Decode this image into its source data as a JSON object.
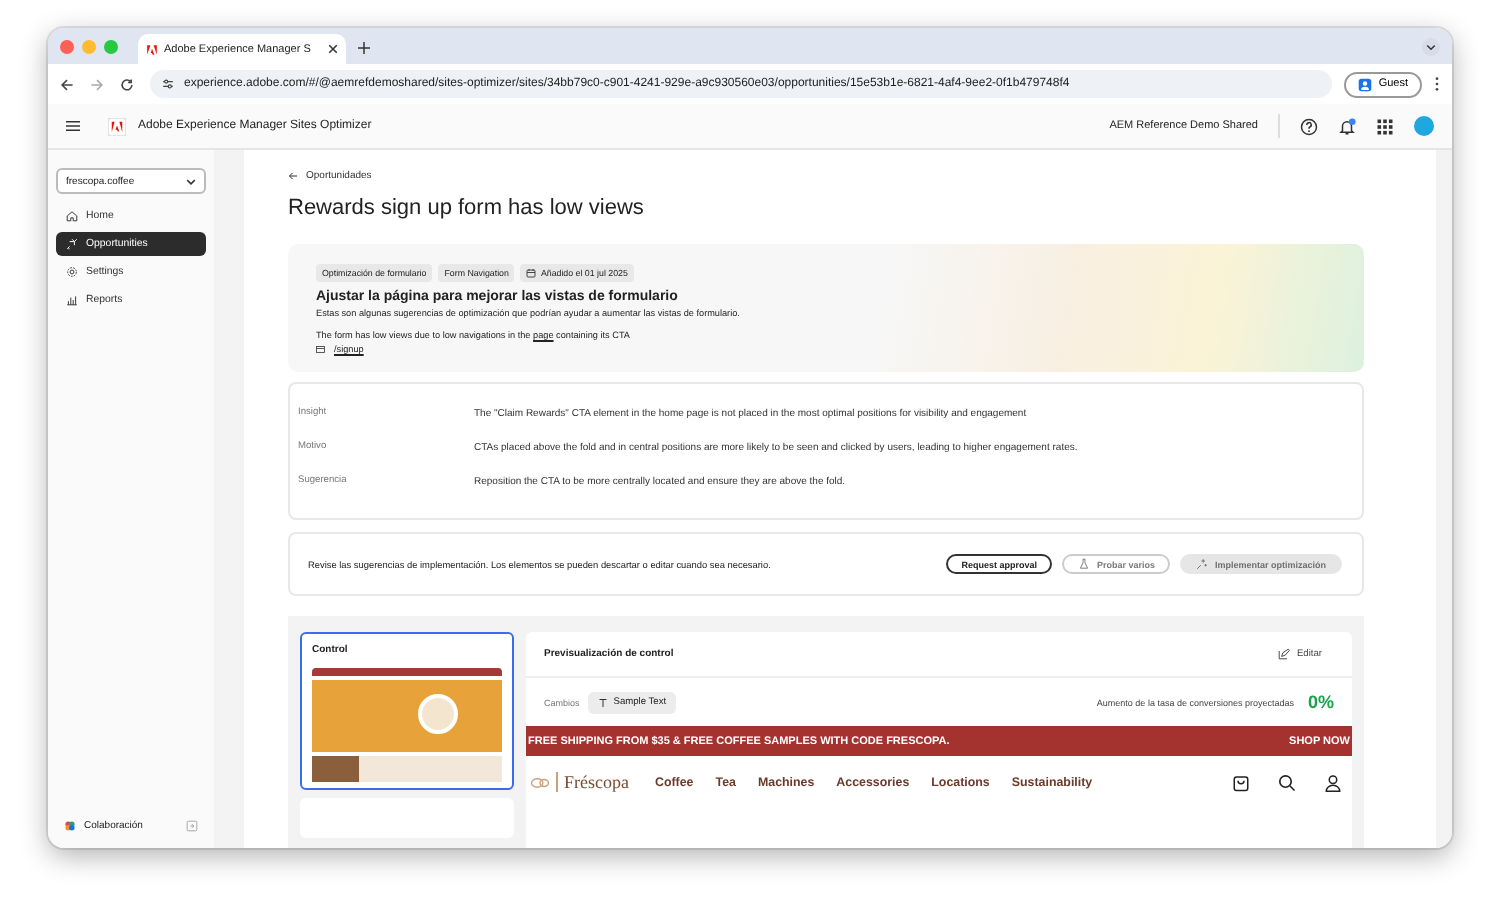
{
  "browser": {
    "tab_title": "Adobe Experience Manager S",
    "url": "experience.adobe.com/#/@aemrefdemoshared/sites-optimizer/sites/34bb79c0-c901-4241-929e-a9c930560e03/opportunities/15e53b1e-6821-4af4-9ee2-0f1b479748f4",
    "profile": "Guest"
  },
  "app_header": {
    "title": "Adobe Experience Manager Sites Optimizer",
    "org": "AEM Reference Demo Shared",
    "notifications": true
  },
  "sidebar": {
    "site": "frescopa.coffee",
    "items": [
      {
        "label": "Home",
        "selected": false
      },
      {
        "label": "Opportunities",
        "selected": true
      },
      {
        "label": "Settings",
        "selected": false
      },
      {
        "label": "Reports",
        "selected": false
      }
    ],
    "footer": "Colaboración"
  },
  "breadcrumb": "Oportunidades",
  "page_title": "Rewards sign up form has low views",
  "opportunity": {
    "tags": [
      "Optimización de formulario",
      "Form Navigation"
    ],
    "date": "Añadido el 01 jul 2025",
    "heading": "Ajustar la página para mejorar las vistas de formulario",
    "description": "Estas son algunas sugerencias de optimización que podrían ayudar a aumentar las vistas de formulario.",
    "reason_before": "The form has low views due to low navigations in the",
    "reason_link": "page",
    "reason_after": "containing its CTA",
    "page_link": "/signup"
  },
  "details": [
    {
      "label": "Insight",
      "value": "The \"Claim Rewards\" CTA element in the home page is not placed in the most optimal positions for visibility and engagement"
    },
    {
      "label": "Motivo",
      "value": "CTAs placed above the fold and in central positions are more likely to be seen and clicked by users, leading to higher engagement rates."
    },
    {
      "label": "Sugerencia",
      "value": "Reposition the CTA to be more centrally located and ensure they are above the fold."
    }
  ],
  "actions": {
    "message": "Revise las sugerencias de implementación. Los elementos se pueden descartar o editar cuando sea necesario.",
    "buttons": [
      {
        "label": "Request approval",
        "kind": "outline",
        "disabled": false
      },
      {
        "label": "Probar varios",
        "kind": "test",
        "disabled": true
      },
      {
        "label": "Implementar optimización",
        "kind": "deploy",
        "disabled": true
      }
    ]
  },
  "variants": [
    {
      "label": "Control",
      "selected": true
    }
  ],
  "preview": {
    "title": "Previsualización de control",
    "edit": "Editar",
    "changes_label": "Cambios",
    "change_chip": "Sample Text",
    "metric_label": "Aumento de la tasa de conversiones proyectadas",
    "metric_value": "0%",
    "banner": "FREE SHIPPING FROM $35 & FREE COFFEE SAMPLES WITH CODE FRESCOPA.",
    "shop_now": "SHOP NOW",
    "logo": "Fréscopa",
    "nav": [
      "Coffee",
      "Tea",
      "Machines",
      "Accessories",
      "Locations",
      "Sustainability"
    ]
  }
}
